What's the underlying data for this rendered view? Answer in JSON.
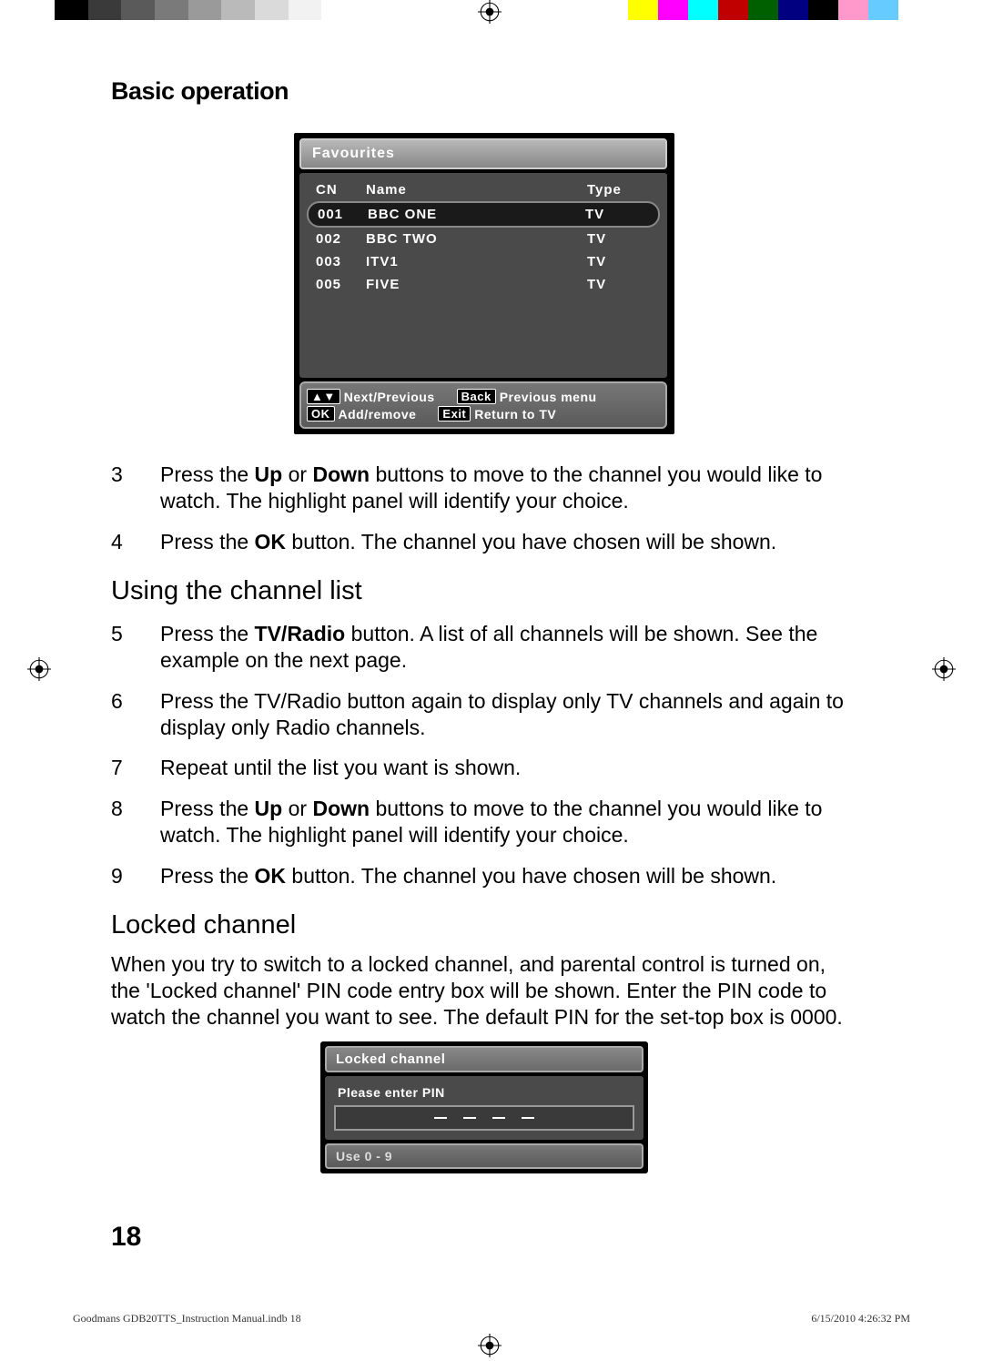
{
  "header": {
    "title": "Basic operation"
  },
  "favourites": {
    "title": "Favourites",
    "columns": {
      "cn": "CN",
      "name": "Name",
      "type": "Type"
    },
    "rows": [
      {
        "cn": "001",
        "name": "BBC ONE",
        "type": "TV",
        "selected": true
      },
      {
        "cn": "002",
        "name": "BBC TWO",
        "type": "TV",
        "selected": false
      },
      {
        "cn": "003",
        "name": "ITV1",
        "type": "TV",
        "selected": false
      },
      {
        "cn": "005",
        "name": "FIVE",
        "type": "TV",
        "selected": false
      }
    ],
    "footer": {
      "navKey": "▲▼",
      "navLabel": "Next/Previous",
      "backKey": "Back",
      "backLabel": "Previous menu",
      "okKey": "OK",
      "okLabel": "Add/remove",
      "exitKey": "Exit",
      "exitLabel": "Return to TV"
    }
  },
  "instructions_a": [
    {
      "num": "3",
      "html": "Press the <b>Up</b> or <b>Down</b> buttons to move to the channel you would like to watch. The highlight panel will identify your choice."
    },
    {
      "num": "4",
      "html": "Press the <b>OK</b> button. The channel you have chosen will be shown."
    }
  ],
  "subhead_a": "Using the channel list",
  "instructions_b": [
    {
      "num": "5",
      "html": "Press the <b>TV/Radio</b> button. A list of all channels will be shown. See the example on the next page."
    },
    {
      "num": "6",
      "html": "Press the TV/Radio button again to display only TV channels and again to display only Radio channels."
    },
    {
      "num": "7",
      "html": "Repeat until the list you want is shown."
    },
    {
      "num": "8",
      "html": "Press the <b>Up</b> or <b>Down</b> buttons to move to the channel you would like to watch. The highlight panel will identify your choice."
    },
    {
      "num": "9",
      "html": "Press the <b>OK</b> button. The channel you have chosen will be shown."
    }
  ],
  "subhead_b": "Locked channel",
  "locked_intro": "When you try to switch to a locked channel, and parental control is turned on, the 'Locked channel' PIN code entry box will be shown. Enter the PIN code to watch the channel you want to see. The default PIN for the set-top box is 0000.",
  "locked_box": {
    "title": "Locked channel",
    "prompt": "Please enter PIN",
    "hint": "Use 0 - 9"
  },
  "page_number": "18",
  "footer": {
    "left": "Goodmans GDB20TTS_Instruction Manual.indb   18",
    "right": "6/15/2010   4:26:32 PM"
  },
  "colorbar_left": [
    "#000",
    "#3a3a3a",
    "#5a5a5a",
    "#7a7a7a",
    "#9a9a9a",
    "#bababa",
    "#dadada",
    "#f2f2f2",
    "#fff"
  ],
  "colorbar_right": [
    "#ffff00",
    "#ff00ff",
    "#00ffff",
    "#c00000",
    "#006000",
    "#000080",
    "#000",
    "#ff99cc",
    "#66ccff",
    "#fff"
  ]
}
